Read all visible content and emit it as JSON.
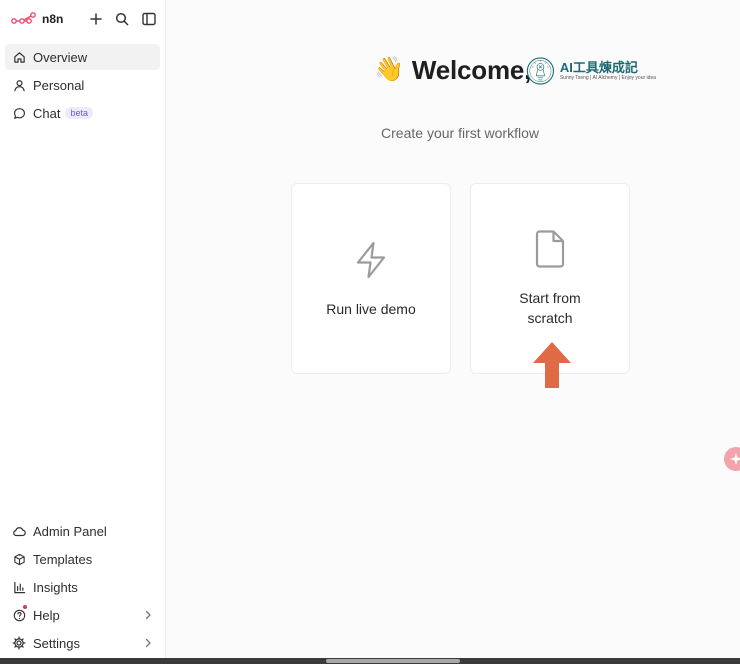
{
  "app": {
    "name": "n8n"
  },
  "sidebar": {
    "nav": [
      {
        "label": "Overview",
        "icon": "home-icon",
        "active": true
      },
      {
        "label": "Personal",
        "icon": "user-icon"
      },
      {
        "label": "Chat",
        "icon": "chat-icon",
        "badge": "beta"
      }
    ],
    "bottom": [
      {
        "label": "Admin Panel",
        "icon": "cloud-icon"
      },
      {
        "label": "Templates",
        "icon": "box-icon"
      },
      {
        "label": "Insights",
        "icon": "bar-chart-icon"
      },
      {
        "label": "Help",
        "icon": "help-icon",
        "has_notification": true,
        "has_chevron": true
      },
      {
        "label": "Settings",
        "icon": "gear-icon",
        "has_chevron": true
      }
    ]
  },
  "main": {
    "greeting_emoji": "👋",
    "greeting": "Welcome,",
    "user_logo": {
      "title": "AI工具煉成記",
      "subtitle": "Sunny Tseng | AI Alchemy | Enjoy your idea"
    },
    "subtitle": "Create your first workflow",
    "cards": [
      {
        "label": "Run live demo",
        "icon": "lightning-icon"
      },
      {
        "label": "Start from scratch",
        "line1": "Start from",
        "line2": "scratch",
        "icon": "file-icon"
      }
    ]
  },
  "colors": {
    "accent": "#ea4b71",
    "annotation_arrow": "#e06a45",
    "logo_teal": "#1c6b74"
  }
}
